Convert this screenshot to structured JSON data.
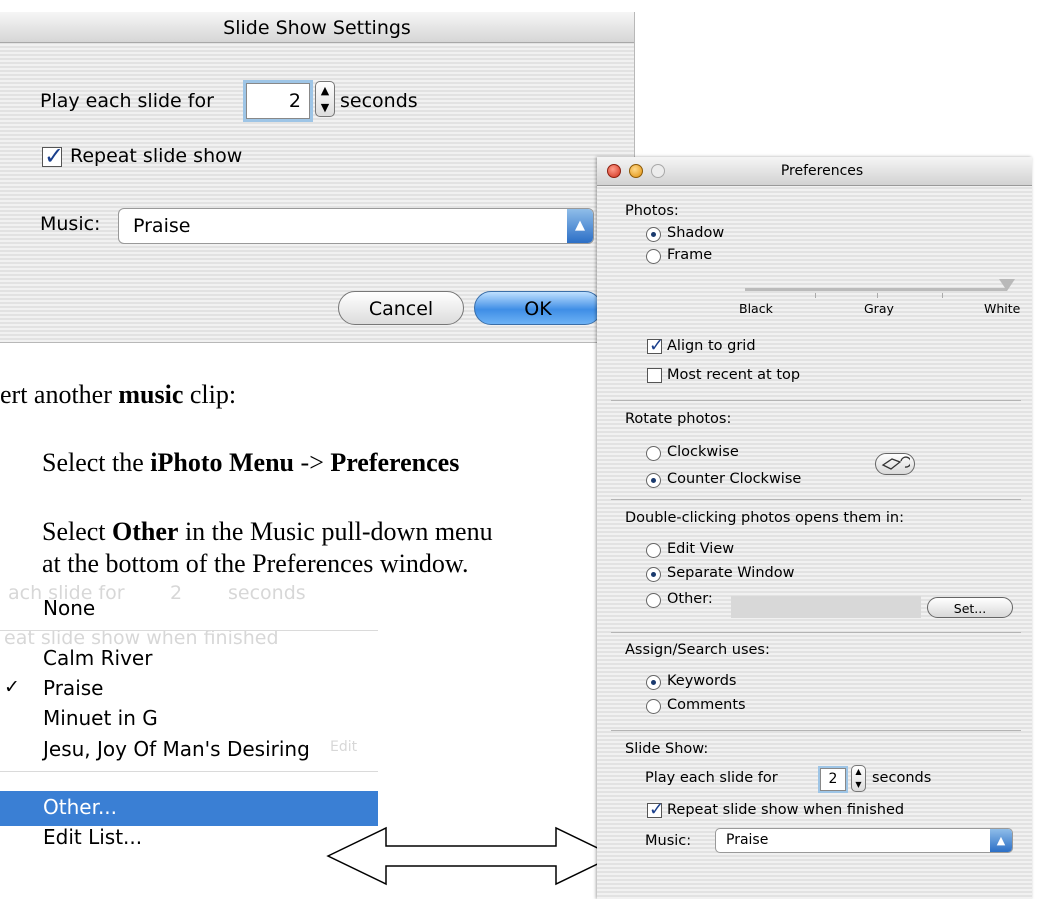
{
  "doc": {
    "line1_prefix": "ert another ",
    "line1_bold": "music",
    "line1_suffix": " clip:",
    "step1_prefix": "Select the ",
    "step1_bold1": "iPhoto Menu",
    "step1_mid": " -> ",
    "step1_bold2": "Preferences",
    "step2_line1_prefix": "Select ",
    "step2_line1_bold": "Other",
    "step2_line1_suffix": " in the Music pull-down menu",
    "step2_line2": "at the bottom of the Preferences window."
  },
  "sheet": {
    "title": "Slide Show Settings",
    "play_label": "Play each slide for",
    "play_value": "2",
    "play_unit": "seconds",
    "repeat_label": "Repeat slide show",
    "repeat_checked": true,
    "music_label": "Music:",
    "music_value": "Praise",
    "cancel_label": "Cancel",
    "ok_label": "OK"
  },
  "prefs": {
    "title": "Preferences",
    "photos_label": "Photos:",
    "shadow_label": "Shadow",
    "frame_label": "Frame",
    "slider_labels": [
      "Black",
      "Gray",
      "White"
    ],
    "slider_value": 1.0,
    "align_label": "Align to grid",
    "align_checked": true,
    "recent_label": "Most recent at top",
    "recent_checked": false,
    "rotate_label": "Rotate photos:",
    "clockwise_label": "Clockwise",
    "counter_label": "Counter Clockwise",
    "dbl_label": "Double-clicking photos opens them in:",
    "edit_view_label": "Edit View",
    "separate_label": "Separate Window",
    "other_label": "Other:",
    "set_label": "Set...",
    "assign_label": "Assign/Search uses:",
    "keywords_label": "Keywords",
    "comments_label": "Comments",
    "slideshow_label": "Slide Show:",
    "play_label": "Play each slide for",
    "play_value": "2",
    "play_unit": "seconds",
    "repeat_label": "Repeat slide show when finished",
    "repeat_checked": true,
    "music_label": "Music:",
    "music_value": "Praise"
  },
  "menu": {
    "ghost_play": "ach slide for",
    "ghost_play_value": "2",
    "ghost_seconds": "seconds",
    "ghost_repeat": "eat slide show when finished",
    "ghost_edit": "Edit",
    "items": [
      "None",
      "Calm River",
      "Praise",
      "Minuet in G",
      "Jesu, Joy Of Man's Desiring",
      "Other...",
      "Edit List..."
    ],
    "checked_item": "Praise",
    "highlighted_item": "Other...",
    "highlight_color": "#3a7fd4"
  }
}
